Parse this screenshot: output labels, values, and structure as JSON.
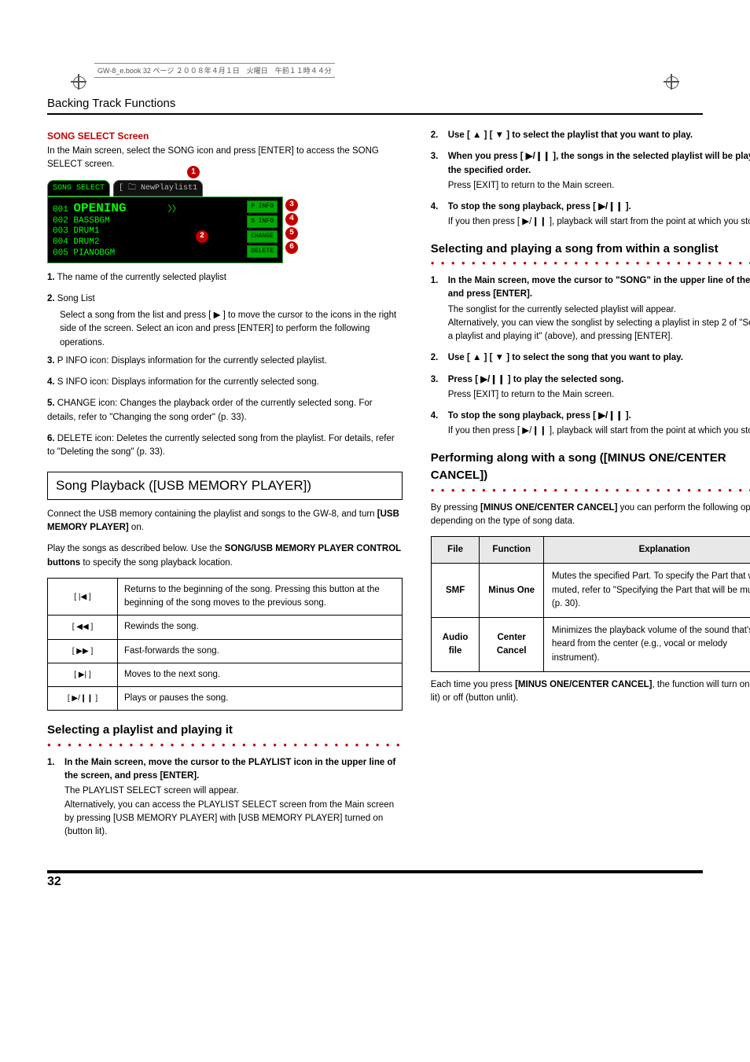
{
  "meta": {
    "header_line": "GW-8_e.book 32 ページ ２００８年４月１日　火曜日　午前１１時４４分"
  },
  "section_title": "Backing Track Functions",
  "song_select": {
    "heading": "SONG SELECT Screen",
    "intro": "In the Main screen, select the SONG icon and press [ENTER] to access the SONG SELECT screen.",
    "screenshot": {
      "tab1": "SONG SELECT",
      "tab2": "[ 🗀 NewPlaylist1",
      "rows": [
        {
          "n": "001",
          "name": "OPENING"
        },
        {
          "n": "002",
          "name": "BASSBGM"
        },
        {
          "n": "003",
          "name": "DRUM1"
        },
        {
          "n": "004",
          "name": "DRUM2"
        },
        {
          "n": "005",
          "name": "PIANOBGM"
        }
      ],
      "side_buttons": [
        "P INFO",
        "S INFO",
        "CHANGE",
        "DELETE"
      ]
    },
    "legend": [
      {
        "n": "1.",
        "text": "The name of the currently selected playlist"
      },
      {
        "n": "2.",
        "text": "Song List",
        "sub": "Select a song from the list and press [ ▶ ] to move the cursor to the icons in the right side of the screen. Select an icon and press [ENTER] to perform the following operations."
      },
      {
        "n": "3.",
        "text": "P INFO icon: Displays information for the currently selected playlist."
      },
      {
        "n": "4.",
        "text": "S INFO icon: Displays information for the currently selected song."
      },
      {
        "n": "5.",
        "text": "CHANGE icon: Changes the playback order of the currently selected song. For details, refer to \"Changing the song order\" (p. 33)."
      },
      {
        "n": "6.",
        "text": "DELETE icon: Deletes the currently selected song from the playlist. For details, refer to \"Deleting the song\" (p. 33)."
      }
    ]
  },
  "playback": {
    "title": "Song Playback ([USB MEMORY PLAYER])",
    "para1_a": "Connect the USB memory containing the playlist and songs to the GW-8, and turn ",
    "para1_b": "[USB MEMORY PLAYER]",
    "para1_c": " on.",
    "para2_a": "Play the songs as described below. Use the ",
    "para2_b": "SONG/USB MEMORY PLAYER CONTROL buttons",
    "para2_c": " to specify the song playback location.",
    "buttons": [
      {
        "icon": "[ |◀ ]",
        "desc": "Returns to the beginning of the song. Pressing this button at the beginning of the song moves to the previous song."
      },
      {
        "icon": "[ ◀◀ ]",
        "desc": "Rewinds the song."
      },
      {
        "icon": "[ ▶▶ ]",
        "desc": "Fast-forwards the song."
      },
      {
        "icon": "[ ▶| ]",
        "desc": "Moves to the next song."
      },
      {
        "icon": "[ ▶/❙❙ ]",
        "desc": "Plays or pauses the song."
      }
    ]
  },
  "select_playlist": {
    "title": "Selecting a playlist and playing it",
    "steps": [
      {
        "n": "1.",
        "lead": "In the Main screen, move the cursor to the PLAYLIST icon in the upper line of the screen, and press [ENTER].",
        "detail": "The PLAYLIST SELECT screen will appear.\nAlternatively, you can access the PLAYLIST SELECT screen from the Main screen by pressing [USB MEMORY PLAYER] with [USB MEMORY PLAYER] turned on (button lit)."
      },
      {
        "n": "2.",
        "lead": "Use [ ▲ ] [ ▼ ] to select the playlist that you want to play."
      },
      {
        "n": "3.",
        "lead": "When you press [ ▶/❙❙ ], the songs in the selected playlist will be played in the specified order.",
        "detail": "Press [EXIT] to return to the Main screen."
      },
      {
        "n": "4.",
        "lead": "To stop the song playback, press [ ▶/❙❙ ].",
        "detail": "If you then press [ ▶/❙❙ ], playback will start from the point at which you stopped."
      }
    ]
  },
  "select_song": {
    "title": "Selecting and playing a song from within a songlist",
    "steps": [
      {
        "n": "1.",
        "lead": "In the Main screen, move the cursor to \"SONG\" in the upper line of the screen, and press [ENTER].",
        "detail": "The songlist for the currently selected playlist will appear.\nAlternatively, you can view the songlist by selecting a playlist in step 2 of \"Selecting a playlist and playing it\" (above), and pressing [ENTER]."
      },
      {
        "n": "2.",
        "lead": "Use [ ▲ ] [ ▼ ] to select the song that you want to play."
      },
      {
        "n": "3.",
        "lead": "Press [ ▶/❙❙ ] to play the selected song.",
        "detail": "Press [EXIT] to return to the Main screen."
      },
      {
        "n": "4.",
        "lead": "To stop the song playback, press [ ▶/❙❙ ].",
        "detail": "If you then press [ ▶/❙❙ ], playback will start from the point at which you stopped."
      }
    ]
  },
  "perform": {
    "title": "Performing along with a song ([MINUS ONE/CENTER CANCEL])",
    "intro_a": "By pressing ",
    "intro_b": "[MINUS ONE/CENTER CANCEL]",
    "intro_c": " you can perform the following operations depending on the type of song data.",
    "headers": [
      "File",
      "Function",
      "Explanation"
    ],
    "rows": [
      {
        "file": "SMF",
        "func": "Minus One",
        "expl": "Mutes the specified Part. To specify the Part that will be muted, refer to \"Specifying the Part that will be muted\" (p. 30)."
      },
      {
        "file": "Audio file",
        "func": "Center Cancel",
        "expl": "Minimizes the playback volume of the sound that's heard from the center (e.g., vocal or melody instrument)."
      }
    ],
    "outro_a": "Each time you press ",
    "outro_b": "[MINUS ONE/CENTER CANCEL]",
    "outro_c": ", the function will turn on (button lit) or off (button unlit)."
  },
  "page_number": "32"
}
